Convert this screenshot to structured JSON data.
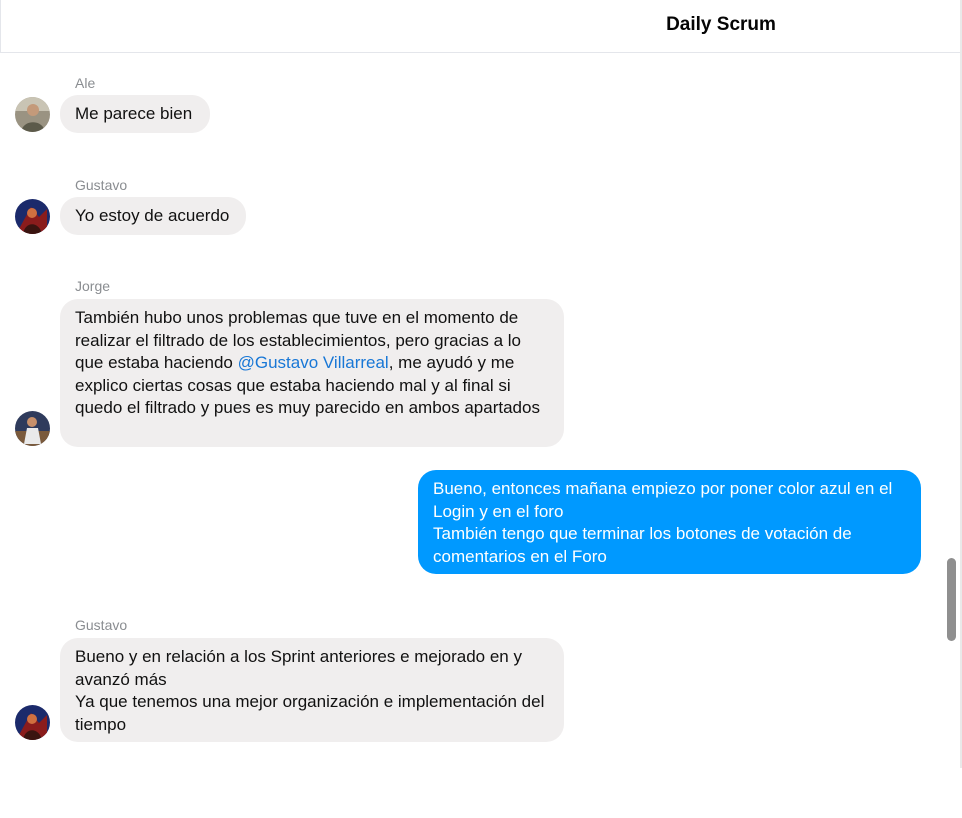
{
  "header": {
    "title": "Daily Scrum"
  },
  "messages": [
    {
      "sender": "Ale",
      "text": "Me parece bien"
    },
    {
      "sender": "Gustavo",
      "text": "Yo estoy de acuerdo"
    },
    {
      "sender": "Jorge",
      "text_before": "También hubo unos problemas que tuve en el momento de realizar el filtrado de los establecimientos, pero gracias a lo que estaba haciendo ",
      "mention": "@Gustavo Villarreal",
      "text_after": ", me ayudó y me explico ciertas cosas que estaba haciendo mal y al final si quedo el filtrado y pues es muy parecido en ambos apartados"
    },
    {
      "sender": "",
      "text": "Bueno, entonces mañana empiezo por poner color azul en el Login y en el foro\nTambién tengo que terminar los botones de votación de comentarios en el Foro"
    },
    {
      "sender": "Gustavo",
      "text": "Bueno y en relación a los Sprint anteriores e mejorado en y avanzó más\nYa que tenemos una mejor organización e implementación del tiempo"
    }
  ],
  "colors": {
    "outgoing_bubble": "#0099ff",
    "incoming_bubble": "#f0eeee",
    "mention": "#1877d6"
  }
}
